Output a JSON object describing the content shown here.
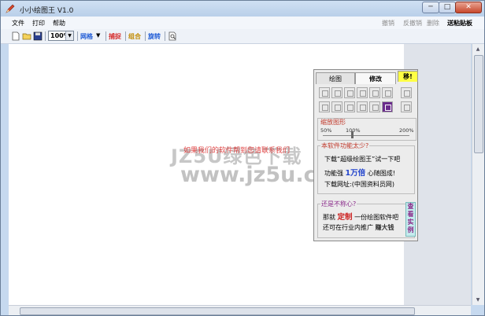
{
  "window": {
    "title": "小小绘图王 V1.0",
    "controls": {
      "minimize": "─",
      "maximize": "□",
      "close": "✕"
    }
  },
  "menu": {
    "items": [
      "文件",
      "打印",
      "帮助"
    ],
    "right": [
      {
        "label": "撤销",
        "enabled": false
      },
      {
        "label": "反撤销",
        "enabled": false
      },
      {
        "label": "删除",
        "enabled": false
      },
      {
        "label": "送粘贴板",
        "enabled": true
      }
    ]
  },
  "toolbar": {
    "zoom_value": "100%",
    "grid_label": "网格",
    "capture_label": "捕捉",
    "group_label": "组合",
    "rotate_label": "旋转",
    "colors": {
      "grid": "#1f5bd6",
      "capture": "#d62b2b",
      "group": "#c08a00",
      "rotate": "#1f5bd6"
    }
  },
  "watermark": {
    "line1": "JZ5U绿色下载",
    "line2": "www.jz5u.com",
    "red_overlay": "如果我们的软件帮到您请联系我们"
  },
  "panel": {
    "tabs": {
      "draw": "绘图",
      "edit": "修改",
      "move": "移!"
    },
    "zoom": {
      "title": "缩放图形",
      "min": "50%",
      "mid": "100%",
      "max": "200%"
    },
    "promo1": {
      "title": "本软件功能太少?",
      "line1": "下载“超级绘图王”试一下吧",
      "line2_prefix": "功能强",
      "line2_highlight": "1万倍",
      "line2_suffix": "心随图成!",
      "line3": "下载网址:(中国资料员网)"
    },
    "promo2": {
      "title": "还是不称心?",
      "line1_prefix": "那就",
      "line1_highlight": "定制",
      "line1_suffix": "一份绘图软件吧",
      "line2_prefix": "还可在行业内推广",
      "line2_highlight": "赚大钱",
      "button": "查看实例"
    }
  }
}
